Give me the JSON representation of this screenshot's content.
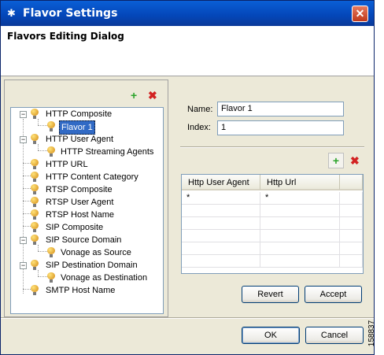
{
  "window": {
    "title": "Flavor Settings",
    "app_icon": "cisco-logo-icon",
    "close_label": "✕"
  },
  "header": {
    "title": "Flavors Editing Dialog"
  },
  "tree": {
    "add_icon": "+",
    "delete_icon": "✖",
    "nodes": [
      {
        "label": "HTTP Composite"
      },
      {
        "label": "Flavor 1"
      },
      {
        "label": "HTTP User Agent"
      },
      {
        "label": "HTTP Streaming Agents"
      },
      {
        "label": "HTTP URL"
      },
      {
        "label": "HTTP Content Category"
      },
      {
        "label": "RTSP Composite"
      },
      {
        "label": "RTSP User Agent"
      },
      {
        "label": "RTSP Host Name"
      },
      {
        "label": "SIP Composite"
      },
      {
        "label": "SIP Source Domain"
      },
      {
        "label": "Vonage as Source"
      },
      {
        "label": "SIP Destination Domain"
      },
      {
        "label": "Vonage as Destination"
      },
      {
        "label": "SMTP Host Name"
      }
    ]
  },
  "form": {
    "name_label": "Name:",
    "name_value": "Flavor 1",
    "index_label": "Index:",
    "index_value": "1"
  },
  "table": {
    "add_icon": "+",
    "delete_icon": "✖",
    "columns": [
      "Http User Agent",
      "Http Url"
    ],
    "rows": [
      [
        "*",
        "*"
      ]
    ]
  },
  "buttons": {
    "revert": "Revert",
    "accept": "Accept",
    "ok": "OK",
    "cancel": "Cancel"
  },
  "figure_id": "158837"
}
